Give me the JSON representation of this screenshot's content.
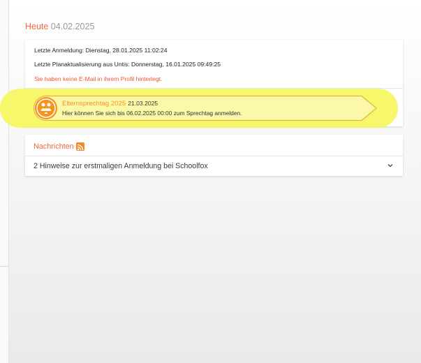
{
  "today": {
    "label": "Heute",
    "date": "04.02.2025"
  },
  "info": {
    "last_login": "Letzte Anmeldung: Dienstag, 28.01.2025 11:02:24",
    "last_update": "Letzte Planaktualisierung aus Untis: Donnerstag, 16.01.2025 09:49:25",
    "email_warning": "Sie haben keine E-Mail in ihrem Profil hinterlegt."
  },
  "event": {
    "title": "Elternsprechtag 2025",
    "date": "21.03.2025",
    "description": "Hier können Sie sich bis 06.02.2025 00:00 zum Sprechtag anmelden.",
    "icon": "parents-icon"
  },
  "news": {
    "heading": "Nachrichten",
    "heading_icon": "rss-icon",
    "items": [
      {
        "text": "2 Hinweise zur erstmaligen Anmeldung bei Schoolfox"
      }
    ]
  },
  "colors": {
    "accent": "#f26b3a",
    "event_orange": "#f7941d",
    "highlight": "#f5f65a",
    "warning": "#f0572e"
  }
}
